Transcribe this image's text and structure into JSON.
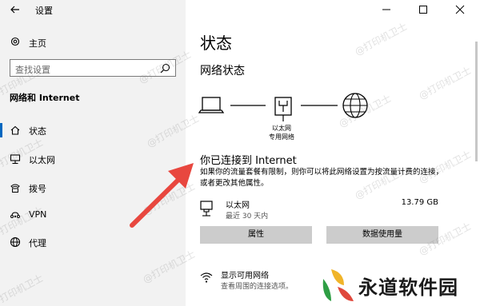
{
  "window": {
    "title": "设置"
  },
  "sidebar": {
    "home_label": "主页",
    "search_placeholder": "查找设置",
    "section_title": "网络和 Internet",
    "items": [
      {
        "label": "状态",
        "icon": "home-status-icon",
        "selected": true
      },
      {
        "label": "以太网",
        "icon": "ethernet-icon"
      },
      {
        "label": "拨号",
        "icon": "phone-icon"
      },
      {
        "label": "VPN",
        "icon": "vpn-icon"
      },
      {
        "label": "代理",
        "icon": "globe-icon"
      }
    ]
  },
  "main": {
    "title": "状态",
    "network_status_title": "网络状态",
    "diagram_label_line1": "以太网",
    "diagram_label_line2": "专用网络",
    "connected_title": "你已连接到 Internet",
    "description": "如果你的流量套餐有限制，则你可以将此网络设置为按流量计费的连接，或者更改其他属性。",
    "ethernet": {
      "name": "以太网",
      "period": "最近 30 天内",
      "usage": "13.79 GB"
    },
    "buttons": {
      "properties": "属性",
      "data_usage": "数据使用量"
    },
    "available": {
      "title": "显示可用网络",
      "subtitle": "查看周围的连接选项。"
    }
  },
  "watermark": "@打印机卫士",
  "logo_text": "永道软件园",
  "colors": {
    "sidebar_bg": "#f2f2f2",
    "accent": "#0067c0",
    "arrow": "#e8473f",
    "button_bg": "#cccccc"
  }
}
